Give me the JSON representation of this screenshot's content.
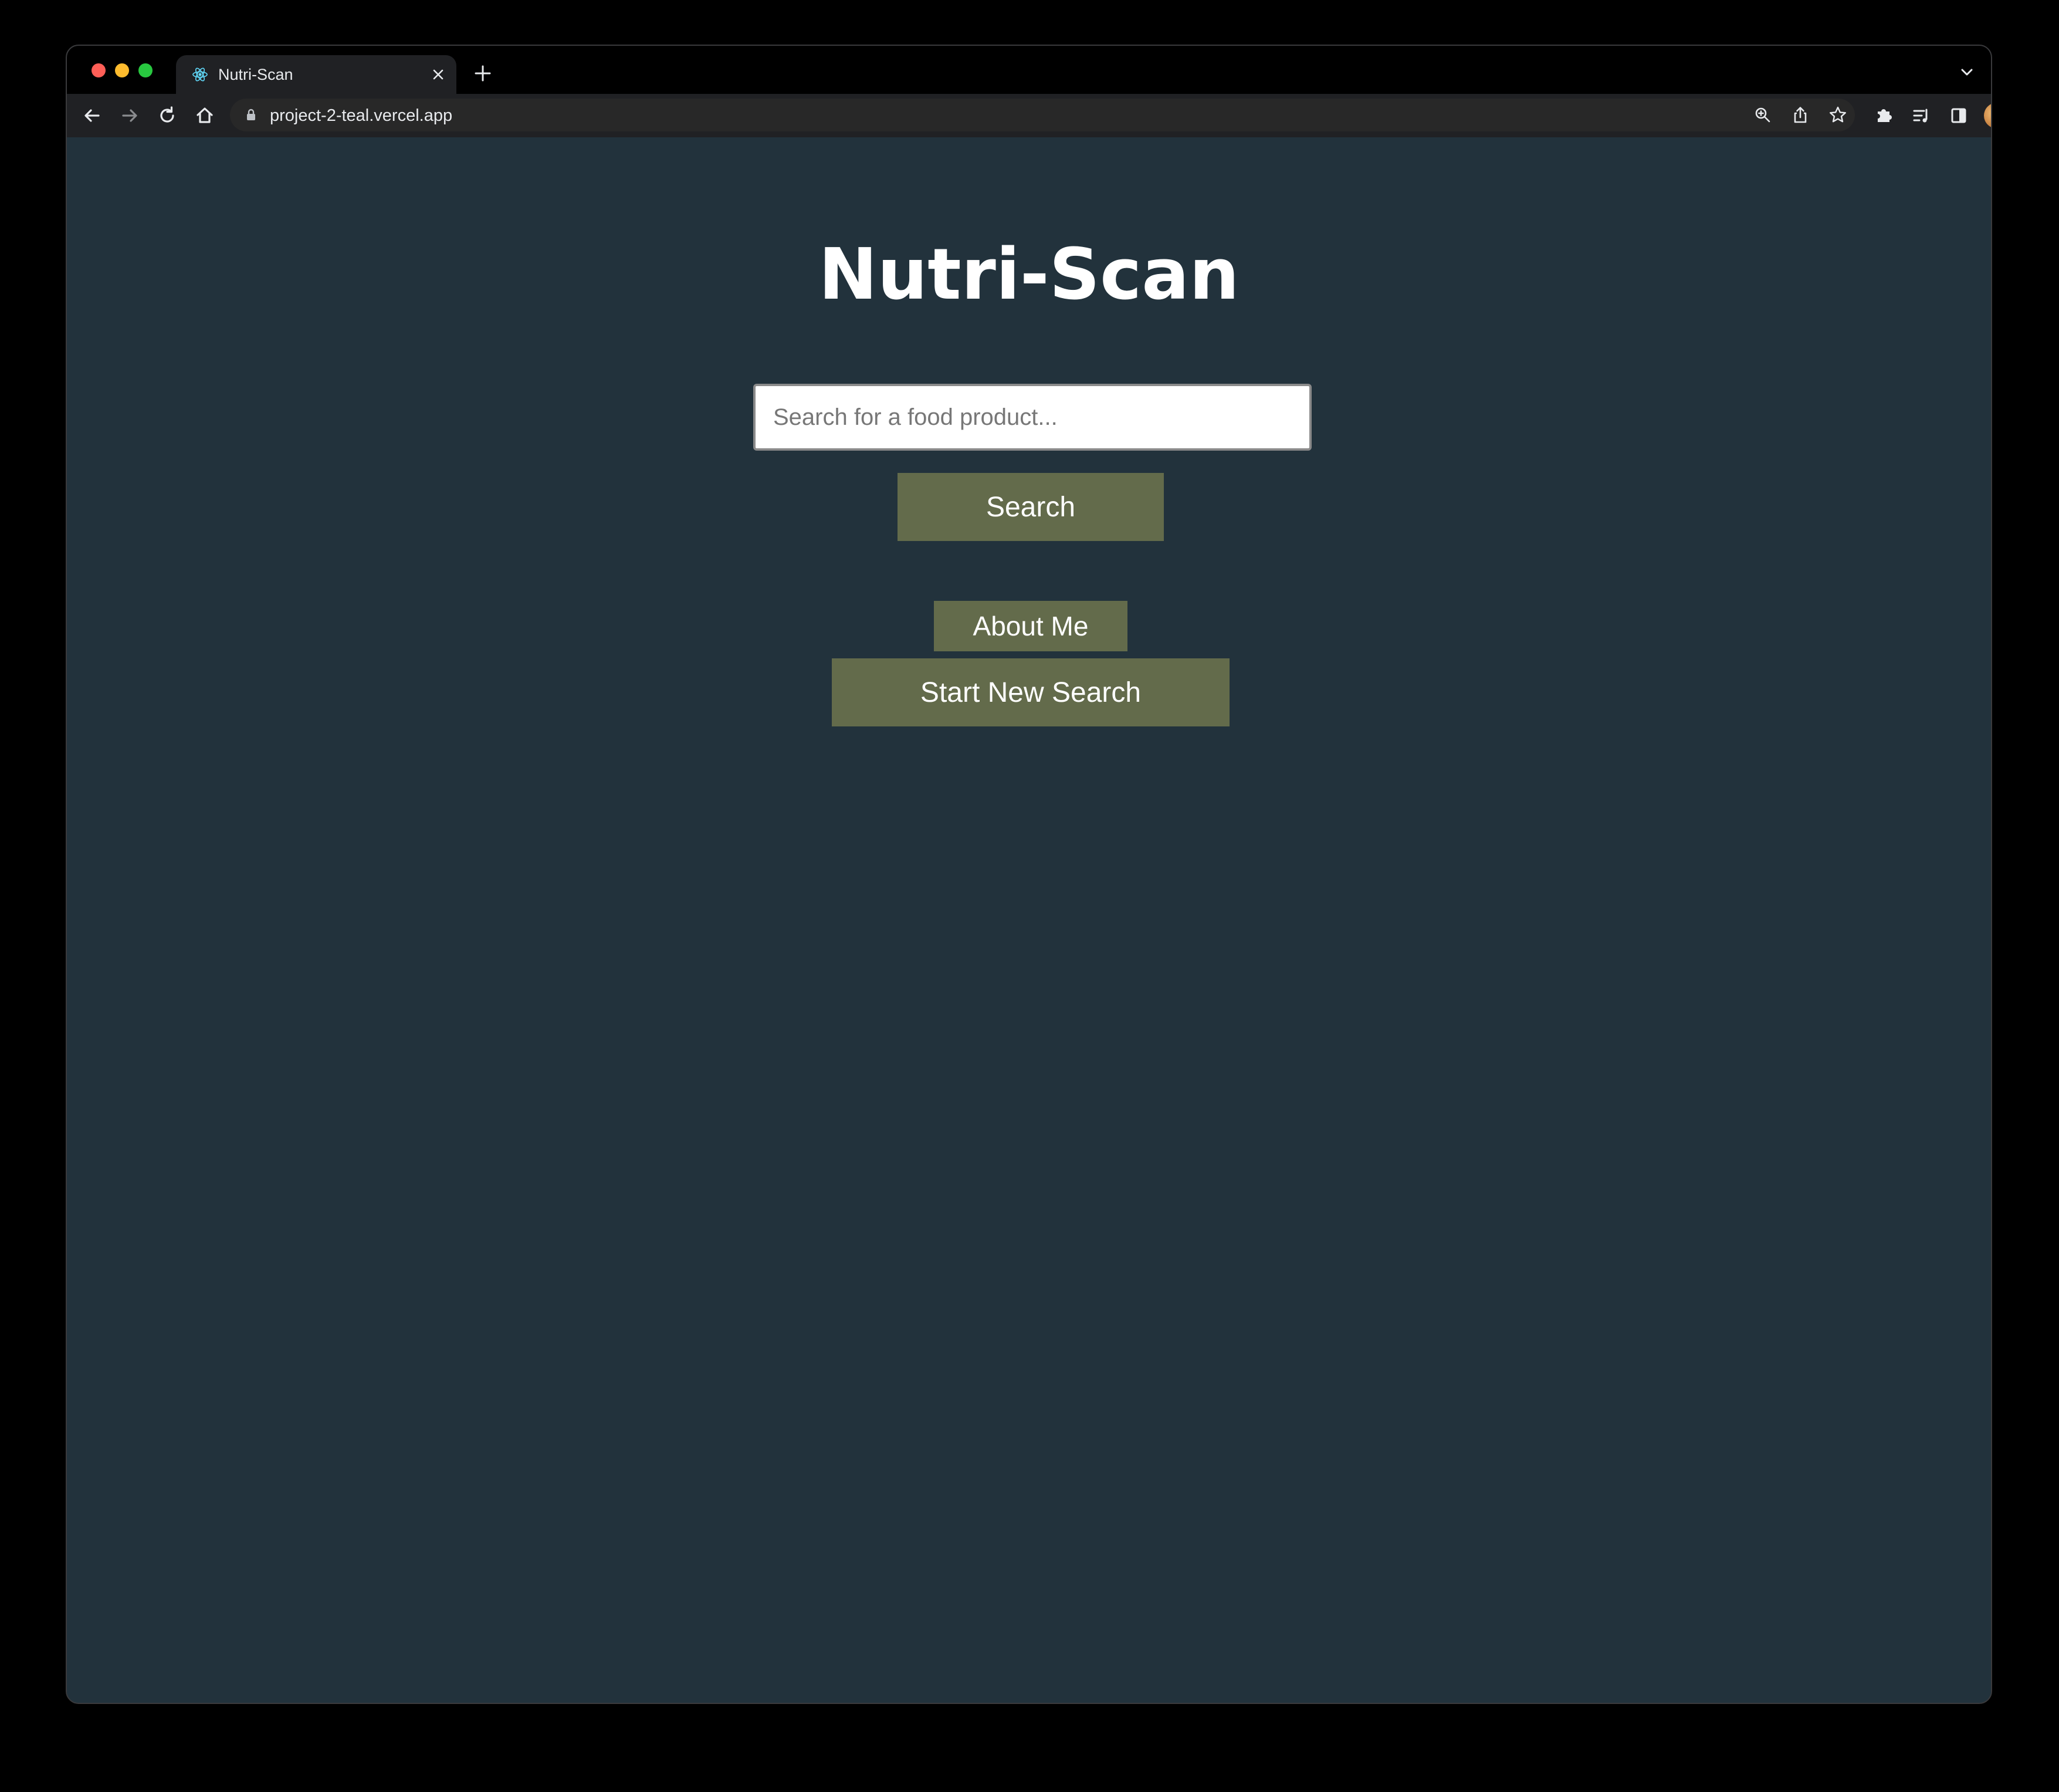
{
  "browser": {
    "tab": {
      "title": "Nutri-Scan"
    },
    "address_bar": {
      "url": "project-2-teal.vercel.app"
    },
    "icons": {
      "back": "back-arrow-icon",
      "forward": "forward-arrow-icon",
      "reload": "reload-icon",
      "home": "home-icon",
      "lock": "lock-icon",
      "zoom": "zoom-icon",
      "share": "share-icon",
      "bookmark": "star-icon",
      "extensions": "puzzle-icon",
      "reading_list": "reading-list-icon",
      "side_panel": "side-panel-icon",
      "menu": "kebab-menu-icon"
    }
  },
  "page": {
    "title": "Nutri-Scan",
    "search": {
      "placeholder": "Search for a food product...",
      "value": "",
      "button_label": "Search"
    },
    "about_button_label": "About Me",
    "new_search_button_label": "Start New Search"
  },
  "colors": {
    "page_background": "#22323c",
    "button_background": "#636b4b",
    "button_text": "#ffffff",
    "title_text": "#ffffff",
    "browser_frame": "#000000",
    "toolbar": "#202124"
  }
}
